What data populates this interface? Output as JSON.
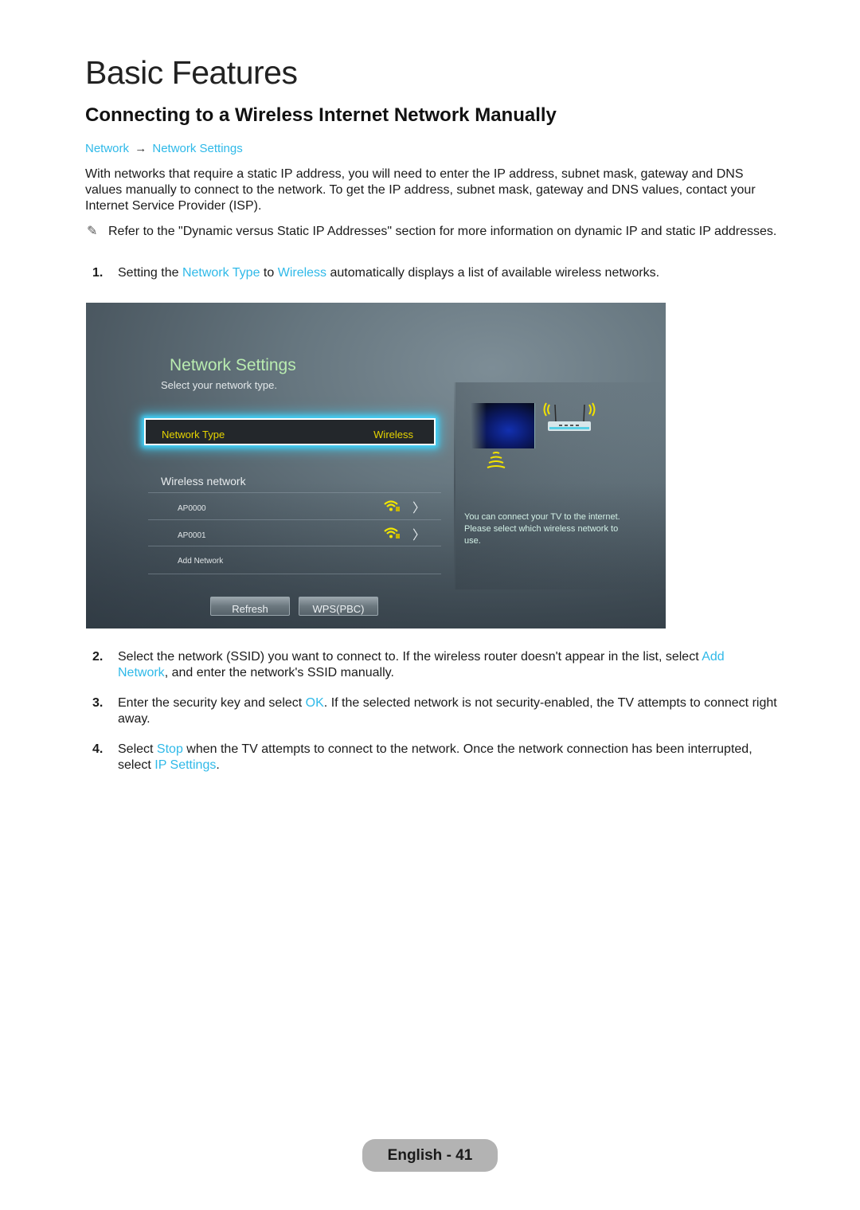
{
  "chapter_title": "Basic Features",
  "section_title": "Connecting to a Wireless Internet Network Manually",
  "breadcrumb": {
    "items": [
      "Network",
      "Network Settings"
    ],
    "separator": "→"
  },
  "intro_paragraph": "With networks that require a static IP address, you will need to enter the IP address, subnet mask, gateway and DNS values manually to connect to the network. To get the IP address, subnet mask, gateway and DNS values, contact your Internet Service Provider (ISP).",
  "note": {
    "icon": "pencil-note-icon",
    "text": "Refer to the \"Dynamic versus Static IP Addresses\" section for more information on dynamic IP and static IP addresses."
  },
  "steps": [
    {
      "num": "1.",
      "parts": [
        "Setting the ",
        "Network Type",
        " to ",
        "Wireless",
        " automatically displays a list of available wireless networks."
      ]
    },
    {
      "num": "2.",
      "parts": [
        "Select the network (SSID) you want to connect to. If the wireless router doesn't appear in the list, select ",
        "Add Network",
        ", and enter the network's SSID manually."
      ]
    },
    {
      "num": "3.",
      "parts": [
        "Enter the security key and select ",
        "OK",
        ". If the selected network is not security-enabled, the TV attempts to connect right away."
      ]
    },
    {
      "num": "4.",
      "parts": [
        "Select ",
        "Stop",
        " when the TV attempts to connect to the network. Once the network connection has been interrupted, select ",
        "IP Settings",
        "."
      ]
    }
  ],
  "tv_screen": {
    "title": "Network Settings",
    "subtitle": "Select your network type.",
    "network_type": {
      "label": "Network Type",
      "value": "Wireless"
    },
    "wireless_section_title": "Wireless network",
    "networks": [
      {
        "name": "AP0000",
        "icon": "wifi-secured-icon"
      },
      {
        "name": "AP0001",
        "icon": "wifi-secured-icon"
      }
    ],
    "add_network_label": "Add Network",
    "buttons": {
      "refresh": "Refresh",
      "wps": "WPS(PBC)"
    },
    "info_text": "You can connect your TV to the internet. Please select which wireless network to use.",
    "colors": {
      "title": "#b9ecb0",
      "highlight": "#e6d400",
      "focus_glow": "#3fd6ff"
    }
  },
  "footer": {
    "page_label": "English - 41"
  },
  "colors": {
    "link": "#2fb9e8"
  }
}
